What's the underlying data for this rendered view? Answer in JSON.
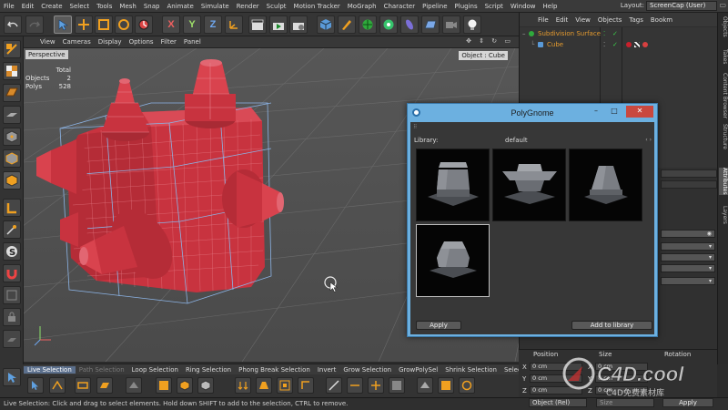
{
  "menubar": {
    "items": [
      "File",
      "Edit",
      "Create",
      "Select",
      "Tools",
      "Mesh",
      "Snap",
      "Animate",
      "Simulate",
      "Render",
      "Sculpt",
      "Motion Tracker",
      "MoGraph",
      "Character",
      "Pipeline",
      "Plugins",
      "Script",
      "Window",
      "Help"
    ],
    "layout_label": "Layout:",
    "layout_value": "ScreenCap (User)"
  },
  "toolbar": {
    "axis_x": "X",
    "axis_y": "Y",
    "axis_z": "Z"
  },
  "viewport": {
    "menu": [
      "View",
      "Cameras",
      "Display",
      "Options",
      "Filter",
      "Panel"
    ],
    "camera_label": "Perspective",
    "selection_label": "Object : Cube",
    "hud": {
      "total_header": "Total",
      "objects_label": "Objects",
      "objects_value": "2",
      "polys_label": "Polys",
      "polys_value": "528"
    },
    "object_color": "#c8333f",
    "wire_color": "#8cb4e6"
  },
  "bottom_tabs": [
    "Live Selection",
    "Path Selection",
    "Loop Selection",
    "Ring Selection",
    "Phong Break Selection",
    "Invert",
    "Grow Selection",
    "GrowPolySel",
    "Shrink Selection",
    "Select Con"
  ],
  "status": "Live Selection: Click and drag to select elements. Hold down SHIFT to add to the selection, CTRL to remove.",
  "object_manager": {
    "menu": [
      "File",
      "Edit",
      "View",
      "Objects",
      "Tags",
      "Bookm"
    ],
    "objects": [
      {
        "name": "Subdivision Surface"
      },
      {
        "name": "Cube"
      }
    ]
  },
  "side_tabs": [
    "Objects",
    "Takes",
    "Content Browser",
    "Structure",
    "Attributes",
    "Layers"
  ],
  "coordinates": {
    "headers": [
      "Position",
      "Size",
      "Rotation"
    ],
    "rows": [
      {
        "axis": "X",
        "pos": "0 cm",
        "size_axis": "X",
        "size": "0 cm"
      },
      {
        "axis": "Y",
        "pos": "0 cm",
        "size_axis": "Y",
        "size": "0 cm"
      },
      {
        "axis": "Z",
        "pos": "0 cm",
        "size_axis": "Z",
        "size": "0 cm"
      }
    ],
    "mode": "Object (Rel)",
    "size_mode": "Size",
    "apply_label": "Apply"
  },
  "polygnome": {
    "title": "PolyGnome",
    "library_label": "Library:",
    "library_value": "default",
    "apply_label": "Apply",
    "add_label": "Add to library",
    "thumbnails": [
      {
        "shape": "stepped-cylinder",
        "selected": false
      },
      {
        "shape": "wide-flange",
        "selected": false
      },
      {
        "shape": "cone-frustum",
        "selected": false
      },
      {
        "shape": "bevelled-cylinder",
        "selected": true
      }
    ]
  },
  "watermark": {
    "logo_text": "C4D.cool",
    "sub_text": "C4D免费素材库"
  }
}
